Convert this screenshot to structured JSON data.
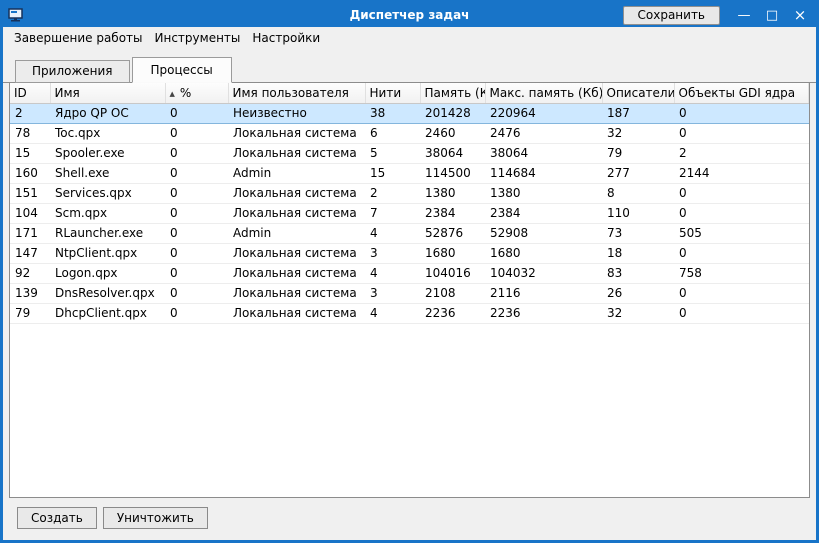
{
  "window": {
    "title": "Диспетчер задач",
    "save_button": "Сохранить",
    "minimize_icon": "—",
    "maximize_icon": "□",
    "close_icon": "×"
  },
  "menu": {
    "items": [
      "Завершение работы",
      "Инструменты",
      "Настройки"
    ]
  },
  "tabs": [
    {
      "label": "Приложения",
      "active": false
    },
    {
      "label": "Процессы",
      "active": true
    }
  ],
  "table": {
    "columns": [
      "ID",
      "Имя",
      "%",
      "Имя пользователя",
      "Нити",
      "Память (Кб)",
      "Макс. память (Кб)",
      "Описатели",
      "Объекты GDI ядра"
    ],
    "sort": {
      "column_index": 2,
      "indicator": "▲"
    },
    "selected_row": 0,
    "rows": [
      [
        "2",
        "Ядро QP ОС",
        "0",
        "Неизвестно",
        "38",
        "201428",
        "220964",
        "187",
        "0"
      ],
      [
        "78",
        "Toc.qpx",
        "0",
        "Локальная система",
        "6",
        "2460",
        "2476",
        "32",
        "0"
      ],
      [
        "15",
        "Spooler.exe",
        "0",
        "Локальная система",
        "5",
        "38064",
        "38064",
        "79",
        "2"
      ],
      [
        "160",
        "Shell.exe",
        "0",
        "Admin",
        "15",
        "114500",
        "114684",
        "277",
        "2144"
      ],
      [
        "151",
        "Services.qpx",
        "0",
        "Локальная система",
        "2",
        "1380",
        "1380",
        "8",
        "0"
      ],
      [
        "104",
        "Scm.qpx",
        "0",
        "Локальная система",
        "7",
        "2384",
        "2384",
        "110",
        "0"
      ],
      [
        "171",
        "RLauncher.exe",
        "0",
        "Admin",
        "4",
        "52876",
        "52908",
        "73",
        "505"
      ],
      [
        "147",
        "NtpClient.qpx",
        "0",
        "Локальная система",
        "3",
        "1680",
        "1680",
        "18",
        "0"
      ],
      [
        "92",
        "Logon.qpx",
        "0",
        "Локальная система",
        "4",
        "104016",
        "104032",
        "83",
        "758"
      ],
      [
        "139",
        "DnsResolver.qpx",
        "0",
        "Локальная система",
        "3",
        "2108",
        "2116",
        "26",
        "0"
      ],
      [
        "79",
        "DhcpClient.qpx",
        "0",
        "Локальная система",
        "4",
        "2236",
        "2236",
        "32",
        "0"
      ]
    ]
  },
  "footer": {
    "create_button": "Создать",
    "destroy_button": "Уничтожить"
  },
  "colors": {
    "titlebar": "#1874c8",
    "selected_row_bg": "#cde8ff",
    "selected_row_border": "#84b6dd"
  }
}
